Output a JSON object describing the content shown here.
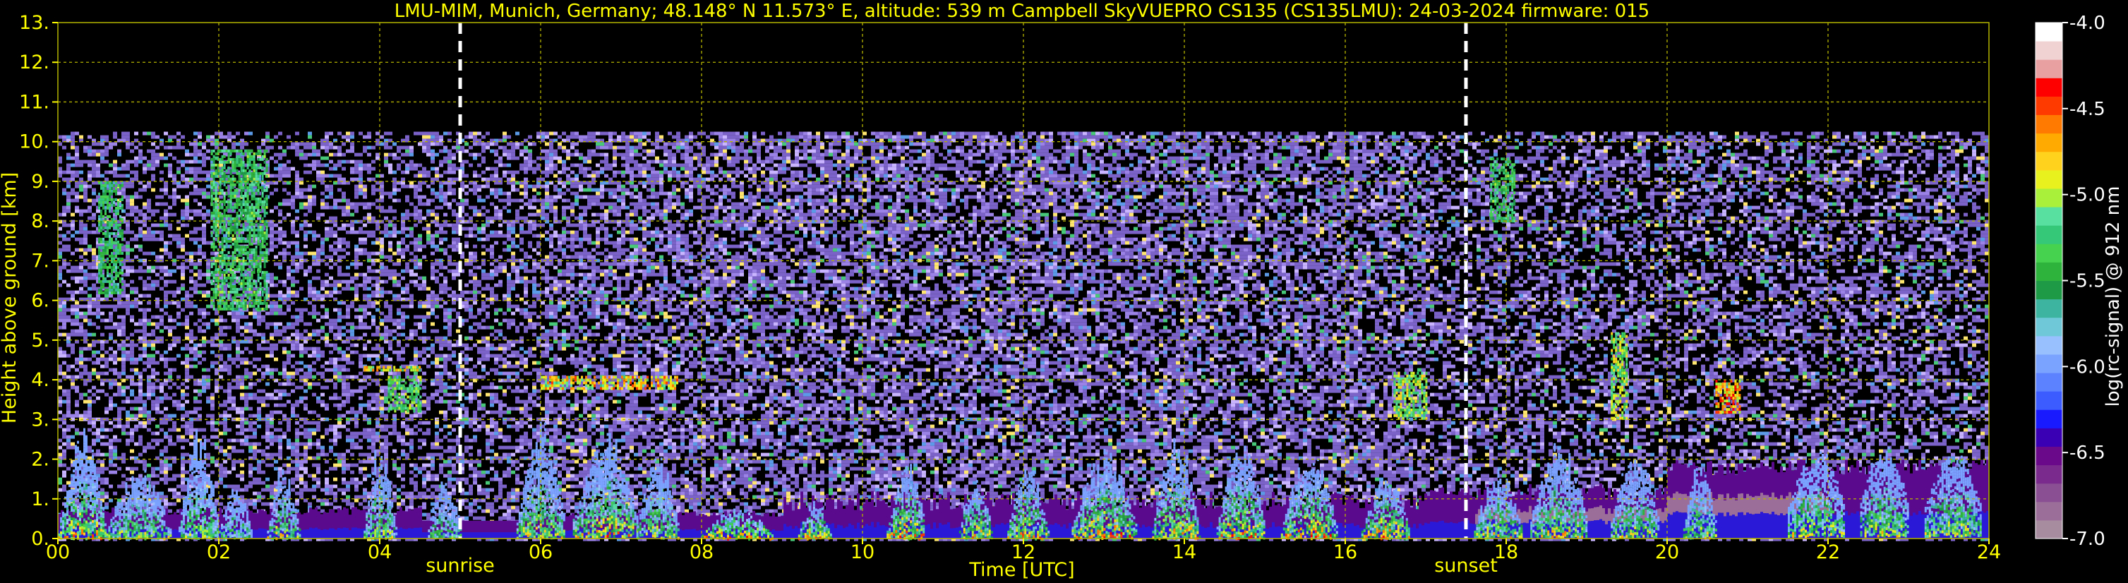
{
  "chart_data": {
    "type": "heatmap",
    "title": "LMU-MIM, Munich, Germany; 48.148° N 11.573° E, altitude: 539 m    Campbell SkyVUEPRO CS135 (CS135LMU): 24-03-2024    firmware: 015",
    "xlabel": "Time [UTC]",
    "ylabel": "Height above ground [km]",
    "xlim": [
      0,
      24
    ],
    "ylim": [
      0,
      13
    ],
    "x_ticks": [
      "00",
      "02",
      "04",
      "06",
      "08",
      "10",
      "12",
      "14",
      "16",
      "18",
      "20",
      "22",
      "24"
    ],
    "y_ticks": [
      "0.",
      "1.",
      "2.",
      "3.",
      "4.",
      "5.",
      "6.",
      "7.",
      "8.",
      "9.",
      "10.",
      "11.",
      "12.",
      "13."
    ],
    "grid": true,
    "sunrise_utc": 5.0,
    "sunset_utc": 17.5,
    "sunrise_label": "sunrise",
    "sunset_label": "sunset",
    "data_top_km": 10.25,
    "colorbar": {
      "label": "log(rc-signal) @ 912 nm",
      "vmin": -7.0,
      "vmax": -4.0,
      "ticks": [
        "-4.0",
        "-4.5",
        "-5.0",
        "-5.5",
        "-6.0",
        "-6.5",
        "-7.0"
      ],
      "colors": [
        "#a78ca0",
        "#9b6e9a",
        "#8a4f92",
        "#7a2a8c",
        "#6a0a8a",
        "#3a00b4",
        "#1a1aff",
        "#3c5cff",
        "#5c82ff",
        "#7aa2ff",
        "#98c0ff",
        "#6fc8d8",
        "#3cb4a0",
        "#1e9a46",
        "#2eb43c",
        "#46d24e",
        "#34c878",
        "#58e0a0",
        "#a8f03a",
        "#e8f01e",
        "#ffd21e",
        "#ffaa00",
        "#ff7a00",
        "#ff3a00",
        "#ff0000",
        "#e8a0a0",
        "#f0d2d2",
        "#ffffff"
      ]
    },
    "annotations": [
      "sunrise",
      "sunset"
    ],
    "style": {
      "text_color": "#ffff00",
      "grid_color": "#b4b400",
      "background": "#000000",
      "marker_color": "#ffffff"
    }
  }
}
